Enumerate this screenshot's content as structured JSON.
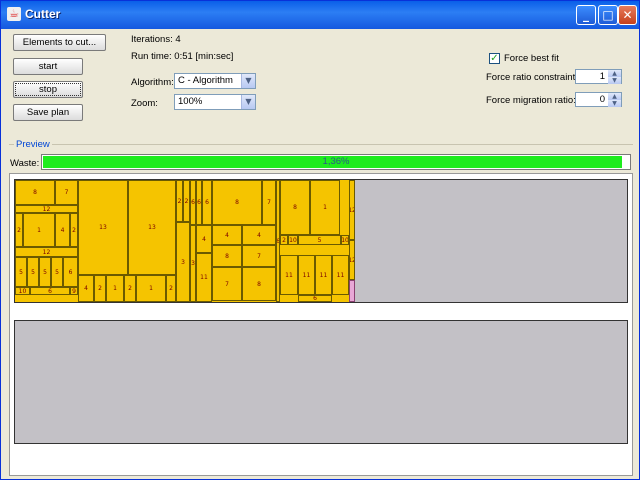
{
  "window": {
    "title": "Cutter",
    "app_icon": "java-coffee-icon",
    "controls": [
      "minimize",
      "maximize",
      "close"
    ]
  },
  "toolbar": {
    "elements_label": "Elements to cut...",
    "start_label": "start",
    "stop_label": "stop",
    "save_label": "Save plan"
  },
  "status": {
    "iterations": "Iterations: 4",
    "runtime": "Run time: 0:51 [min:sec]"
  },
  "algorithm": {
    "label": "Algorithm:",
    "value": "C - Algorithm"
  },
  "zoom": {
    "label": "Zoom:",
    "value": "100%"
  },
  "options": {
    "force_best_fit_label": "Force best fit",
    "force_best_fit_checked": true,
    "ratio_label": "Force ratio constraint:",
    "ratio_value": "1",
    "migration_label": "Force migration ratio:",
    "migration_value": "0"
  },
  "preview": {
    "legend": "Preview",
    "waste_label": "Waste:",
    "waste_percent": "1,36%",
    "waste_progress_fraction": 0.984,
    "fill_color": "#1eec1e",
    "piece_color": "#f5c400",
    "plate_color": "#c3c1c6"
  },
  "pieces": [
    {
      "label": "8"
    },
    {
      "label": "7"
    },
    {
      "label": "12"
    },
    {
      "label": "2"
    },
    {
      "label": "1"
    },
    {
      "label": "4"
    },
    {
      "label": "2"
    },
    {
      "label": "12"
    },
    {
      "label": "5"
    },
    {
      "label": "5"
    },
    {
      "label": "5"
    },
    {
      "label": "5"
    },
    {
      "label": "6"
    },
    {
      "label": "10"
    },
    {
      "label": "6"
    },
    {
      "label": "9"
    },
    {
      "label": "13"
    },
    {
      "label": "13"
    },
    {
      "label": "4"
    },
    {
      "label": "2"
    },
    {
      "label": "1"
    },
    {
      "label": "2"
    },
    {
      "label": "1"
    },
    {
      "label": "2"
    },
    {
      "label": "2"
    },
    {
      "label": "2"
    },
    {
      "label": "3"
    },
    {
      "label": "6"
    },
    {
      "label": "6"
    },
    {
      "label": "6"
    },
    {
      "label": "4"
    },
    {
      "label": "3"
    },
    {
      "label": "11"
    },
    {
      "label": "8"
    },
    {
      "label": "7"
    },
    {
      "label": "4"
    },
    {
      "label": "4"
    },
    {
      "label": "8"
    },
    {
      "label": "7"
    },
    {
      "label": "7"
    },
    {
      "label": "8"
    },
    {
      "label": "8"
    },
    {
      "label": "1"
    },
    {
      "label": "2"
    },
    {
      "label": "10"
    },
    {
      "label": "5"
    },
    {
      "label": "10"
    },
    {
      "label": "11"
    },
    {
      "label": "11"
    },
    {
      "label": "11"
    },
    {
      "label": "11"
    },
    {
      "label": "6"
    },
    {
      "label": "6"
    },
    {
      "label": "12"
    },
    {
      "label": "12"
    }
  ]
}
